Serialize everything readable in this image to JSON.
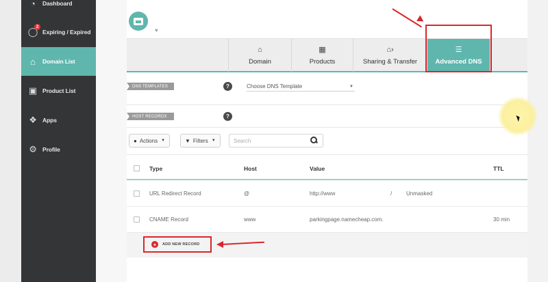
{
  "sidebar": {
    "items": [
      {
        "label": "Dashboard",
        "icon": "gauge-icon"
      },
      {
        "label": "Expiring / Expired",
        "icon": "stopwatch-icon",
        "badge": "2"
      },
      {
        "label": "Domain List",
        "icon": "home-icon",
        "active": true
      },
      {
        "label": "Product List",
        "icon": "box-icon"
      },
      {
        "label": "Apps",
        "icon": "apps-icon"
      },
      {
        "label": "Profile",
        "icon": "gear-icon"
      }
    ]
  },
  "tabs": [
    {
      "label": "Domain",
      "icon": "home-icon"
    },
    {
      "label": "Products",
      "icon": "cube-icon"
    },
    {
      "label": "Sharing & Transfer",
      "icon": "share-home-icon"
    },
    {
      "label": "Advanced DNS",
      "icon": "dns-icon",
      "active": true
    }
  ],
  "dns_templates": {
    "tag": "DNS TEMPLATES",
    "help": "?",
    "select_value": "Choose DNS Template"
  },
  "host_records": {
    "tag": "HOST RECORDS",
    "help": "?"
  },
  "toolbar": {
    "actions_label": "Actions",
    "filters_label": "Filters",
    "search_placeholder": "Search"
  },
  "table": {
    "headers": [
      "Type",
      "Host",
      "Value",
      "TTL"
    ],
    "rows": [
      {
        "type": "URL Redirect Record",
        "host": "@",
        "value": "http://www",
        "value_sep": "/",
        "value_extra": "Unmasked",
        "ttl": ""
      },
      {
        "type": "CNAME Record",
        "host": "www",
        "value": "parkingpage.namecheap.com.",
        "value_sep": "",
        "value_extra": "",
        "ttl": "30 min"
      }
    ]
  },
  "add_record_label": "ADD NEW RECORD",
  "colors": {
    "accent": "#5fb6ad",
    "sidebar": "#333537",
    "annotation": "#d9262a"
  }
}
